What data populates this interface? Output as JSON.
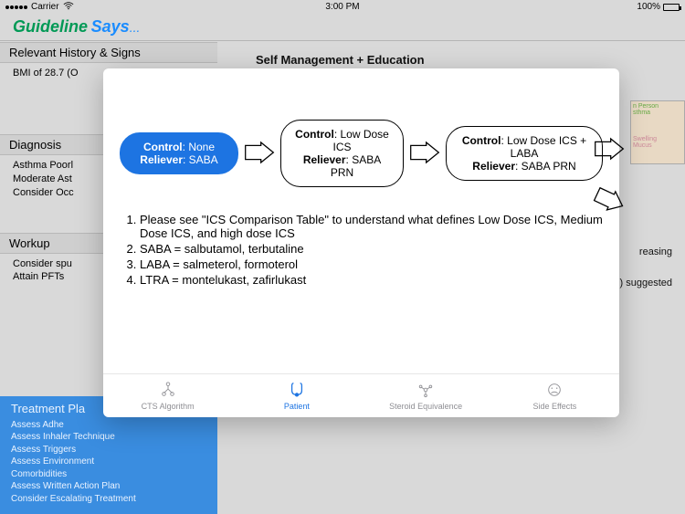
{
  "statusbar": {
    "carrier": "Carrier",
    "wifi": "wifi",
    "time": "3:00 PM",
    "battery_pct": "100%"
  },
  "brand": {
    "guideline": "Guideline",
    "says": "Says",
    "dots": "..."
  },
  "sections": {
    "relevant": {
      "title": "Relevant History & Signs",
      "items": [
        "BMI of 28.7 (O"
      ]
    },
    "diagnosis": {
      "title": "Diagnosis",
      "items": [
        "Asthma Poorl",
        "Moderate Ast",
        "Consider Occ"
      ]
    },
    "workup": {
      "title": "Workup",
      "items": [
        "Consider spu",
        "Attain PFTs"
      ]
    }
  },
  "right_header": "Self Management + Education",
  "side_text": {
    "a": "reasing",
    "b": ") suggested"
  },
  "side_img_labels": {
    "top": "n Person\nsthma",
    "sw": "Swelling",
    "mu": "Mucus"
  },
  "treatment": {
    "title": "Treatment Pla",
    "items": [
      "Assess Adhe",
      "Assess Inhaler Technique",
      "Assess Triggers",
      "Assess Environment",
      "Comorbidities",
      "Assess Written Action Plan",
      "Consider Escalating Treatment"
    ]
  },
  "modal": {
    "steps": [
      {
        "control_label": "Control",
        "control": "None",
        "reliever_label": "Reliever",
        "reliever": "SABA",
        "style": "blue"
      },
      {
        "control_label": "Control",
        "control": "Low Dose ICS",
        "reliever_label": "Reliever",
        "reliever": "SABA PRN",
        "style": ""
      },
      {
        "control_label": "Control",
        "control": "Low Dose ICS + LABA",
        "reliever_label": "Reliever",
        "reliever": "SABA PRN",
        "style": ""
      }
    ],
    "notes": [
      "Please see \"ICS Comparison Table\" to understand what defines Low Dose ICS, Medium Dose ICS, and high dose ICS",
      "SABA = salbutamol, terbutaline",
      "LABA = salmeterol, formoterol",
      "LTRA = montelukast, zafirlukast"
    ],
    "tabs": [
      {
        "id": "cts",
        "label": "CTS Algorithm"
      },
      {
        "id": "patient",
        "label": "Patient"
      },
      {
        "id": "steroid",
        "label": "Steroid Equivalence"
      },
      {
        "id": "side",
        "label": "Side Effects"
      }
    ],
    "active_tab": "patient"
  }
}
